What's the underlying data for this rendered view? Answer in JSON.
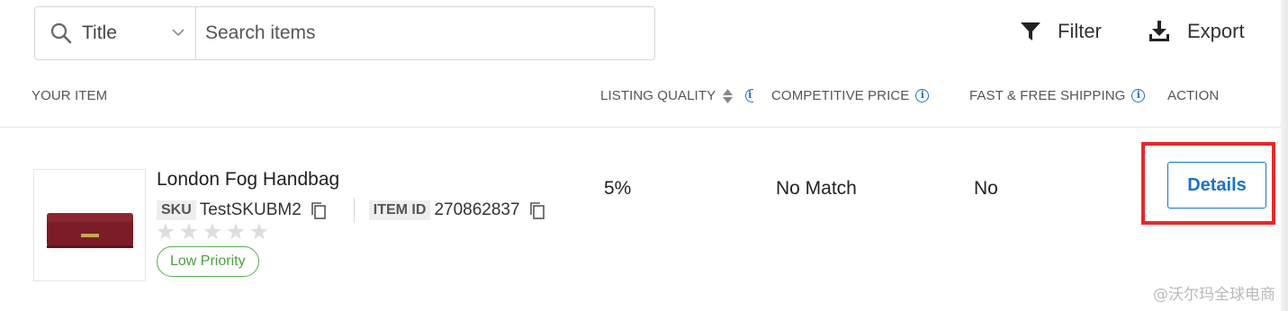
{
  "search": {
    "field_selected": "Title",
    "placeholder": "Search items"
  },
  "toolbar": {
    "filter_label": "Filter",
    "export_label": "Export"
  },
  "columns": {
    "your_item": "YOUR ITEM",
    "listing_quality": "LISTING QUALITY",
    "competitive_price": "COMPETITIVE PRICE",
    "fast_free_shipping": "FAST & FREE SHIPPING",
    "action": "ACTION"
  },
  "item": {
    "title": "London Fog Handbag",
    "sku_label": "SKU",
    "sku": "TestSKUBM2",
    "item_id_label": "ITEM ID",
    "item_id": "270862837",
    "rating_stars": 0,
    "priority": "Low Priority",
    "listing_quality": "5%",
    "competitive_price": "No Match",
    "fast_free_shipping": "No",
    "action_label": "Details"
  },
  "watermark": "@沃尔玛全球电商",
  "colors": {
    "accent_blue": "#1a73c8",
    "priority_green": "#58b04e",
    "highlight_red": "#e8282a"
  }
}
